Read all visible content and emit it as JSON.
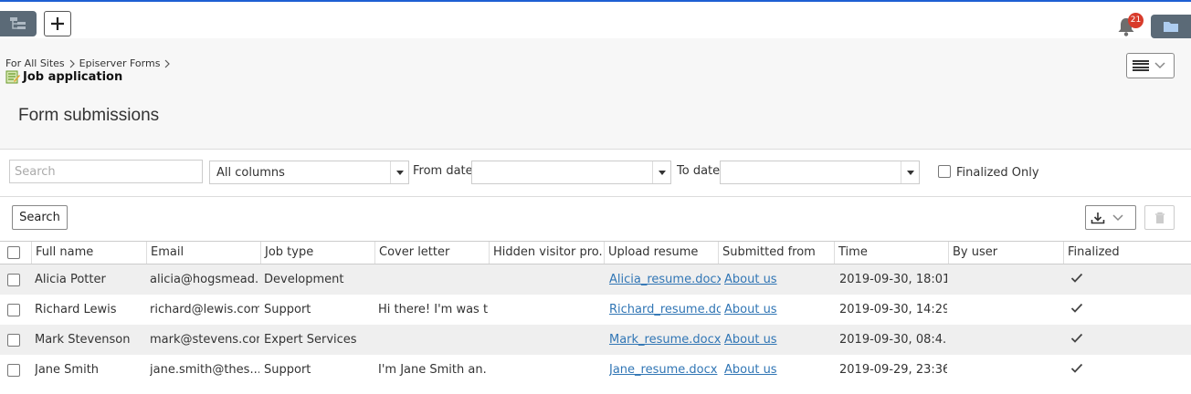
{
  "topbar": {
    "notification_count": "21"
  },
  "breadcrumb": [
    "For All Sites",
    "Episerver Forms"
  ],
  "page": {
    "item_title": "Job application",
    "heading": "Form submissions"
  },
  "filters": {
    "search_placeholder": "Search",
    "column_select": "All columns",
    "from_date_label": "From date",
    "to_date_label": "To date",
    "finalized_only_label": "Finalized Only"
  },
  "toolbar": {
    "search_label": "Search"
  },
  "table": {
    "columns": [
      "Full name",
      "Email",
      "Job type",
      "Cover letter",
      "Hidden visitor pro...",
      "Upload resume",
      "Submitted from",
      "Time",
      "By user",
      "Finalized"
    ],
    "rows": [
      {
        "full_name": "Alicia Potter",
        "email": "alicia@hogsmead...",
        "job_type": "Development",
        "cover_letter": "",
        "hidden": "",
        "resume": "Alicia_resume.docx",
        "submitted_from": "About us",
        "time": "2019-09-30, 18:01...",
        "by_user": "",
        "finalized": true
      },
      {
        "full_name": "Richard Lewis",
        "email": "richard@lewis.com",
        "job_type": "Support",
        "cover_letter": "Hi there! I'm was t...",
        "hidden": "",
        "resume": "Richard_resume.docx",
        "submitted_from": "About us",
        "time": "2019-09-30, 14:29...",
        "by_user": "",
        "finalized": true
      },
      {
        "full_name": "Mark Stevenson",
        "email": "mark@stevens.com",
        "job_type": "Expert Services",
        "cover_letter": "",
        "hidden": "",
        "resume": "Mark_resume.docx",
        "submitted_from": "About us",
        "time": "2019-09-30, 08:4...",
        "by_user": "",
        "finalized": true
      },
      {
        "full_name": "Jane Smith",
        "email": "jane.smith@thes...",
        "job_type": "Support",
        "cover_letter": "I'm Jane Smith an...",
        "hidden": "",
        "resume": "Jane_resume.docx",
        "submitted_from": "About us",
        "time": "2019-09-29, 23:36...",
        "by_user": "",
        "finalized": true
      }
    ]
  },
  "colors": {
    "accent_top": "#1d5fd3",
    "dark_button": "#5b6a77",
    "badge": "#d83b2b",
    "link": "#3176b5",
    "alt_row": "#efefef"
  },
  "icons": [
    "tree-icon",
    "plus-icon",
    "bell-icon",
    "folder-icon",
    "form-icon",
    "menu-lines-icon",
    "chevron-down-icon",
    "download-icon",
    "trash-icon",
    "checkmark-icon"
  ]
}
